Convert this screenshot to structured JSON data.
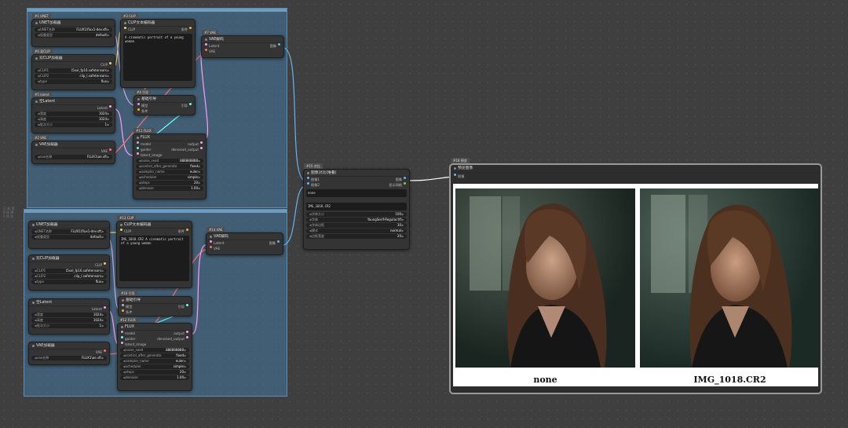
{
  "groups": [
    {
      "label": ""
    },
    {
      "label": ""
    }
  ],
  "side_note": [
    "已 启 用",
    "0 选 择",
    "0 合 适"
  ],
  "top": {
    "unet": {
      "tag": "#1 UNET",
      "title": "UNET加载器",
      "name_label": "UNET名称",
      "name_value": "FLUX1\\flux1-dev.sft",
      "dtype_label": "权重类型",
      "dtype_value": "default"
    },
    "dualclip": {
      "tag": "#6 双CLIP",
      "title": "双CLIP加载器",
      "out": "CLIP",
      "clip1_label": "CLIP1",
      "clip1_value": "t5xxl_fp16.safetensors",
      "clip2_label": "CLIP2",
      "clip2_value": "clip_l.safetensors",
      "type_label": "type",
      "type_value": "flux"
    },
    "latent": {
      "tag": "#5 latent",
      "title": "空Latent",
      "out": "Latent",
      "w_label": "宽度",
      "w_value": "1024",
      "h_label": "高度",
      "h_value": "1024",
      "b_label": "批次大小",
      "b_value": "1"
    },
    "vae": {
      "tag": "#2 VAE",
      "title": "VAE加载器",
      "out": "VAE",
      "name_label": "vae名称",
      "name_value": "FLUX1\\ae.sft"
    },
    "clipenc": {
      "tag": "#3 CLIP",
      "title": "CLIP文本编码器",
      "in": "CLIP",
      "out": "条件",
      "text": "A cinematic portrait of a young woman"
    },
    "guide": {
      "tag": "#4 引导",
      "title": "基础引导",
      "in1": "模型",
      "in2": "条件",
      "out": "引导"
    },
    "flux": {
      "tag": "#11 FLUX",
      "title": "FLUX",
      "in1": "model",
      "in2": "guider",
      "in3": "latent_image",
      "out1": "output",
      "out2": "denoised_output",
      "widgets": [
        {
          "l": "noise_seed",
          "v": "888888888"
        },
        {
          "l": "control_after_generate",
          "v": "fixed"
        },
        {
          "l": "sampler_name",
          "v": "euler"
        },
        {
          "l": "scheduler",
          "v": "simple"
        },
        {
          "l": "steps",
          "v": "20"
        },
        {
          "l": "denoise",
          "v": "1.00"
        }
      ]
    },
    "vaedec": {
      "tag": "#7 VAE",
      "title": "VAE解码",
      "in1": "Latent",
      "in2": "VAE",
      "out": "图像"
    }
  },
  "bottom": {
    "unet": {
      "title": "UNET加载器",
      "name_label": "UNET名称",
      "name_value": "FLUX1\\flux1-dev.sft",
      "dtype_label": "权重类型",
      "dtype_value": "default"
    },
    "dualclip": {
      "title": "双CLIP加载器",
      "out": "CLIP",
      "clip1_label": "CLIP1",
      "clip1_value": "t5xxl_fp16.safetensors",
      "clip2_label": "CLIP2",
      "clip2_value": "clip_l.safetensors",
      "type_label": "type",
      "type_value": "flux"
    },
    "latent": {
      "title": "空Latent",
      "out": "Latent",
      "w_label": "宽度",
      "w_value": "1024",
      "h_label": "高度",
      "h_value": "1024",
      "b_label": "批次大小",
      "b_value": "1"
    },
    "vae": {
      "title": "VAE加载器",
      "out": "VAE",
      "name_label": "vae名称",
      "name_value": "FLUX1\\ae.sft"
    },
    "clipenc": {
      "tag": "#13 CLIP",
      "title": "CLIP文本编码器",
      "in": "CLIP",
      "out": "条件",
      "text": "IMG_1018.CR2 A cinematic portrait of a young woman"
    },
    "guide": {
      "tag": "#16 引导",
      "title": "基础引导",
      "in1": "模型",
      "in2": "条件",
      "out": "引导"
    },
    "flux": {
      "tag": "#12 FLUX",
      "title": "FLUX",
      "in1": "model",
      "in2": "guider",
      "in3": "latent_image",
      "out1": "output",
      "out2": "denoised_output",
      "widgets": [
        {
          "l": "noise_seed",
          "v": "888888888"
        },
        {
          "l": "control_after_generate",
          "v": "fixed"
        },
        {
          "l": "sampler_name",
          "v": "euler"
        },
        {
          "l": "scheduler",
          "v": "simple"
        },
        {
          "l": "steps",
          "v": "20"
        },
        {
          "l": "denoise",
          "v": "1.00"
        }
      ]
    },
    "vaedec": {
      "tag": "#14 VAE",
      "title": "VAE解码",
      "in1": "Latent",
      "in2": "VAE",
      "out": "图像"
    }
  },
  "compare": {
    "tag": "#15 对比",
    "title": "图像对比(堆叠)",
    "in1": "图像1",
    "in2": "图像2",
    "out1": "图像",
    "out2": "显示网格",
    "text1": "none",
    "text2": "IMG_1018.CR2",
    "widgets": [
      {
        "l": "字体大小",
        "v": "100"
      },
      {
        "l": "字体",
        "v": "YoungSerif-Regular.ttf"
      },
      {
        "l": "字体边距",
        "v": "30"
      },
      {
        "l": "模式",
        "v": "normal"
      },
      {
        "l": "边框宽度",
        "v": "20"
      }
    ]
  },
  "preview": {
    "tag": "#16 预览",
    "title": "预览图像",
    "in": "图像",
    "caption1": "none",
    "caption2": "IMG_1018.CR2"
  },
  "colors": {
    "clip": "#f2d35a",
    "model": "#c6a9e0",
    "latent": "#ff9cf9",
    "vae": "#ff6e6e",
    "conditioning": "#ffa931",
    "image": "#64b5f6",
    "guider": "#66ffff"
  }
}
